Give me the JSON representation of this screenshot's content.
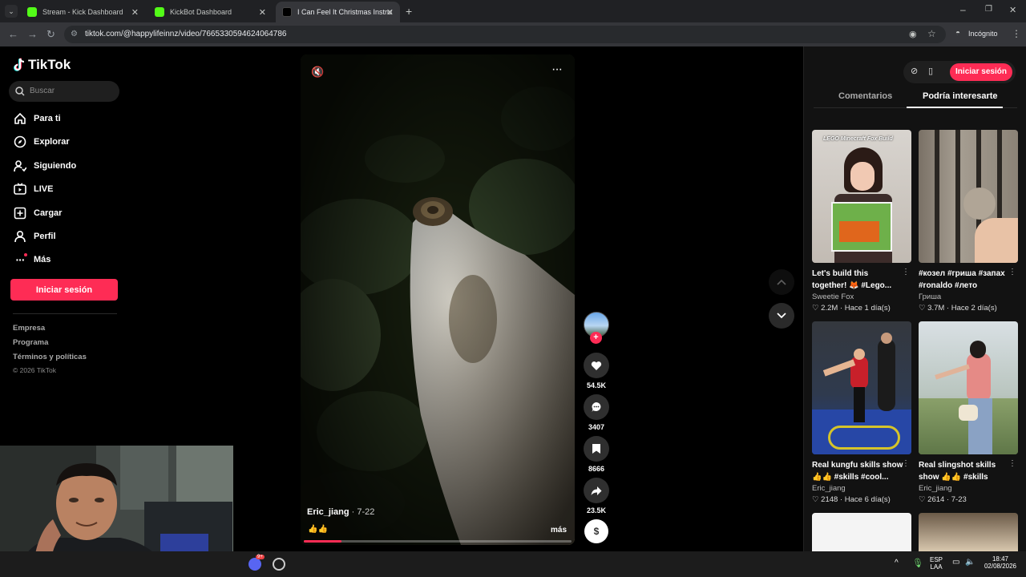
{
  "tabs": [
    {
      "title": "Stream - Kick Dashboard",
      "favicon_color": "#53fc18"
    },
    {
      "title": "KickBot Dashboard",
      "favicon_color": "#53fc18"
    },
    {
      "title": "I Can Feel It Christmas Instrume",
      "favicon_color": "#ffffff",
      "active": true
    }
  ],
  "address": {
    "url": "tiktok.com/@happylifeinnz/video/7665330594624064786",
    "incognito_label": "Incógnito"
  },
  "sidebar": {
    "logo": "TikTok",
    "search_placeholder": "Buscar",
    "nav": [
      {
        "label": "Para ti",
        "icon": "home-icon"
      },
      {
        "label": "Explorar",
        "icon": "compass-icon"
      },
      {
        "label": "Siguiendo",
        "icon": "following-icon"
      },
      {
        "label": "LIVE",
        "icon": "live-icon"
      },
      {
        "label": "Cargar",
        "icon": "upload-icon"
      },
      {
        "label": "Perfil",
        "icon": "profile-icon"
      },
      {
        "label": "Más",
        "icon": "more-icon"
      }
    ],
    "login_button": "Iniciar sesión",
    "footer": [
      "Empresa",
      "Programa",
      "Términos y políticas",
      "© 2026 TikTok"
    ]
  },
  "video": {
    "author": "Eric_jiang",
    "date": " · 7-22",
    "caption": "👍👍",
    "more": "más",
    "progress_fraction": 0.14,
    "actions": {
      "likes": "54.5K",
      "comments": "3407",
      "saves": "8666",
      "shares": "23.5K"
    }
  },
  "right_panel": {
    "login_button": "Iniciar sesión",
    "tabs": [
      "Comentarios",
      "Podría interesarte"
    ],
    "active_tab": "Podría interesarte",
    "cards": [
      {
        "title": "Let's build this together! 🦊 #Lego...",
        "thumb_text": "LEGO Minecraft Fox Build",
        "author": "Sweetie Fox",
        "likes": "2.2M",
        "when": "Hace 1 día(s)"
      },
      {
        "title": "#козел #гриша #запах #ronaldo #лето",
        "thumb_text": "",
        "author": "Гриша",
        "likes": "3.7M",
        "when": "Hace 2 día(s)"
      },
      {
        "title": "Real kungfu skills show 👍👍 #skills #cool...",
        "thumb_text": "",
        "author": "Eric_jiang",
        "likes": "2148",
        "when": "Hace 6 día(s)"
      },
      {
        "title": "Real slingshot skills show 👍👍 #skills #co...",
        "thumb_text": "",
        "author": "Eric_jiang",
        "likes": "2614",
        "when": "7-23"
      }
    ]
  },
  "taskbar": {
    "lang": "ESP",
    "layout": "LAA",
    "time": "18:47",
    "date": "02/08/2026",
    "badge": "9+"
  },
  "colors": {
    "accent": "#fe2c55",
    "background": "#000000",
    "panel": "#121212"
  }
}
